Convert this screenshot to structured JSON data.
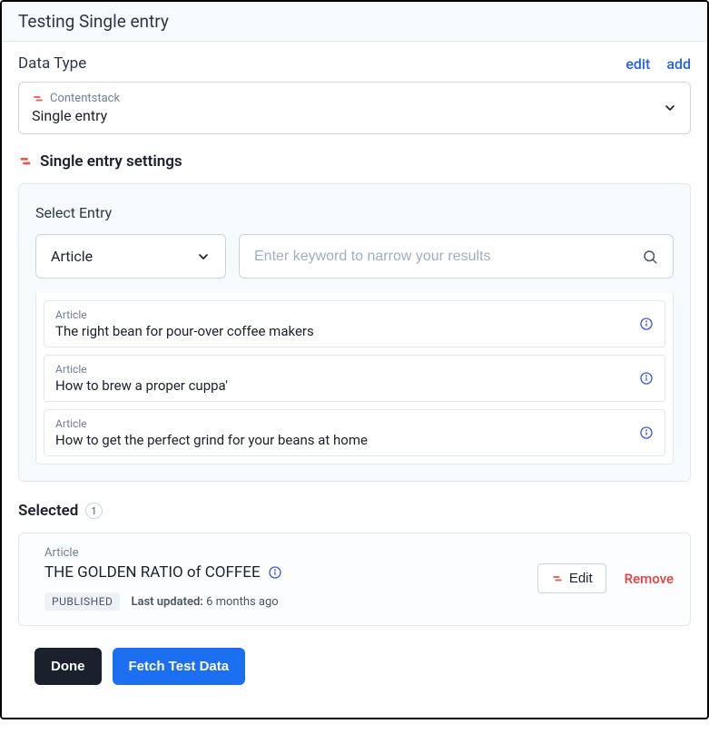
{
  "header": {
    "title": "Testing Single entry"
  },
  "dataType": {
    "label": "Data Type",
    "editLabel": "edit",
    "addLabel": "add",
    "provider": "Contentstack",
    "value": "Single entry"
  },
  "settings": {
    "heading": "Single entry settings",
    "selectEntryLabel": "Select Entry",
    "contentTypeSelect": "Article",
    "searchPlaceholder": "Enter keyword to narrow your results",
    "results": [
      {
        "type": "Article",
        "title": "The right bean for pour-over coffee makers"
      },
      {
        "type": "Article",
        "title": "How to brew a proper cuppa'"
      },
      {
        "type": "Article",
        "title": "How to get the perfect grind for your beans at home"
      }
    ]
  },
  "selected": {
    "heading": "Selected",
    "count": "1",
    "type": "Article",
    "title": "THE GOLDEN RATIO of COFFEE",
    "status": "PUBLISHED",
    "updatedLabel": "Last updated:",
    "updatedValue": "6 months ago",
    "editLabel": "Edit",
    "removeLabel": "Remove"
  },
  "footer": {
    "done": "Done",
    "fetch": "Fetch Test Data"
  }
}
